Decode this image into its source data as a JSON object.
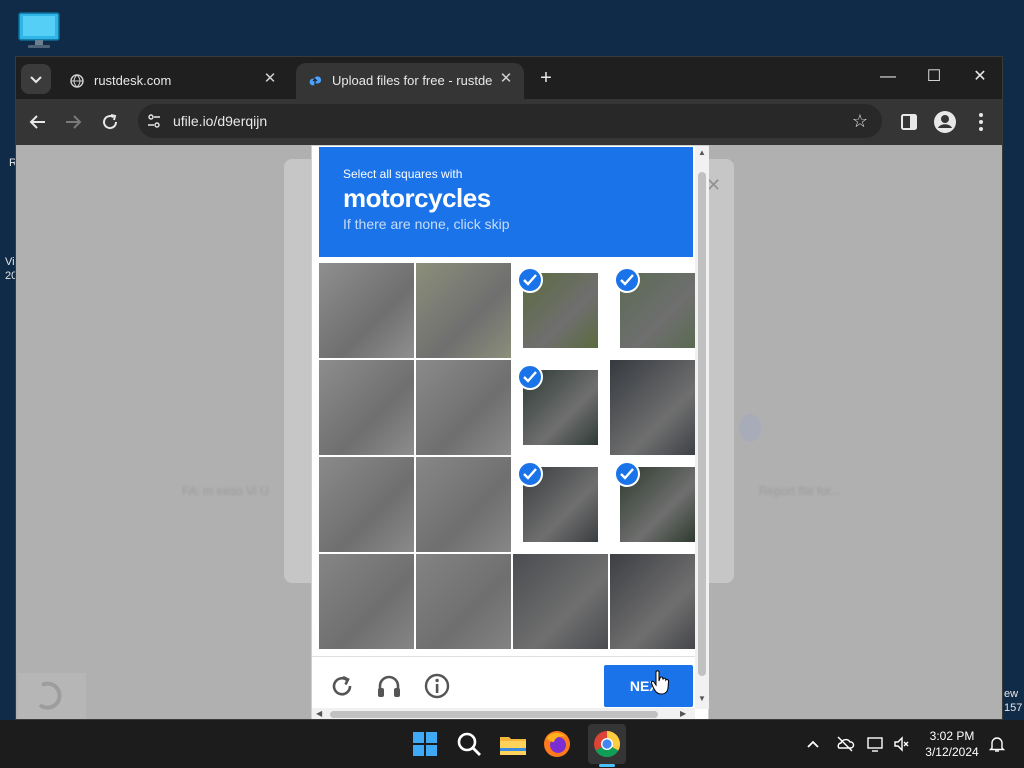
{
  "desktop": {
    "fragments": [
      "R",
      "Vi",
      "20",
      "ew",
      "157"
    ]
  },
  "browser": {
    "tabs": [
      {
        "title": "rustdesk.com",
        "close": "✕"
      },
      {
        "title": "Upload files for free - rustdesk-",
        "close": "✕"
      }
    ],
    "new_tab": "+",
    "url": "ufile.io/d9erqijn",
    "window_controls": {
      "minimize": "—",
      "maximize": "☐",
      "close": "✕"
    }
  },
  "page": {
    "faint_left": "FA: m  eeso  Vi U",
    "faint_right": "Report file for..."
  },
  "captcha": {
    "instruction": "Select all squares with",
    "target": "motorcycles",
    "hint": "If there are none, click skip",
    "button_label": "NEXT",
    "tiles": [
      {
        "row": 0,
        "col": 0,
        "selected": false
      },
      {
        "row": 0,
        "col": 1,
        "selected": false
      },
      {
        "row": 0,
        "col": 2,
        "selected": true
      },
      {
        "row": 0,
        "col": 3,
        "selected": true
      },
      {
        "row": 1,
        "col": 0,
        "selected": false
      },
      {
        "row": 1,
        "col": 1,
        "selected": false
      },
      {
        "row": 1,
        "col": 2,
        "selected": true
      },
      {
        "row": 1,
        "col": 3,
        "selected": false
      },
      {
        "row": 2,
        "col": 0,
        "selected": false
      },
      {
        "row": 2,
        "col": 1,
        "selected": false
      },
      {
        "row": 2,
        "col": 2,
        "selected": true
      },
      {
        "row": 2,
        "col": 3,
        "selected": true
      },
      {
        "row": 3,
        "col": 0,
        "selected": false
      },
      {
        "row": 3,
        "col": 1,
        "selected": false
      },
      {
        "row": 3,
        "col": 2,
        "selected": false
      },
      {
        "row": 3,
        "col": 3,
        "selected": false
      }
    ],
    "icons": [
      "reload-icon",
      "audio-challenge-icon",
      "info-icon"
    ]
  },
  "taskbar": {
    "apps": [
      "start-icon",
      "search-icon",
      "file-explorer-icon",
      "firefox-icon",
      "chrome-icon"
    ],
    "time": "3:02 PM",
    "date": "3/12/2024"
  },
  "colors": {
    "accent": "#1a73e8",
    "tab_bg": "#1f1f1f",
    "toolbar_bg": "#353535"
  }
}
